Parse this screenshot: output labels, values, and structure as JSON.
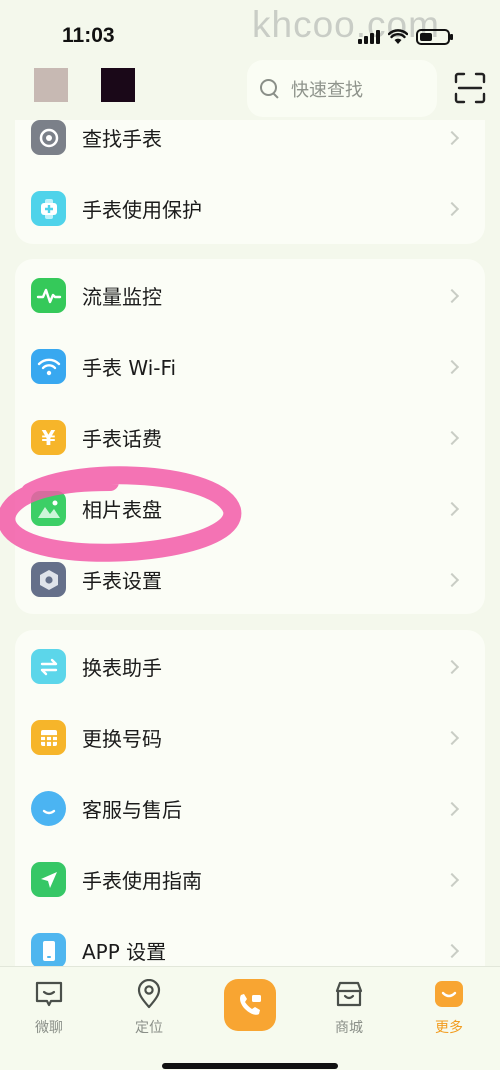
{
  "status_bar": {
    "time": "11:03",
    "watermark": "khcoo.com"
  },
  "search": {
    "placeholder": "快速查找"
  },
  "card1": {
    "items": [
      {
        "label": "查找手表",
        "icon": "target-icon",
        "color": "#7b8089"
      },
      {
        "label": "手表使用保护",
        "icon": "watch-plus-icon",
        "color": "#4fd3ea"
      }
    ]
  },
  "card2": {
    "items": [
      {
        "label": "流量监控",
        "icon": "pulse-icon",
        "color": "#35c95a"
      },
      {
        "label": "手表 Wi-Fi",
        "icon": "wifi-icon",
        "color": "#38a8f0"
      },
      {
        "label": "手表话费",
        "icon": "yen-icon",
        "color": "#f6b52a"
      },
      {
        "label": "相片表盘",
        "icon": "photo-icon",
        "color": "#3ccf66"
      },
      {
        "label": "手表设置",
        "icon": "hexagon-gear-icon",
        "color": "#65708a"
      }
    ]
  },
  "card3": {
    "items": [
      {
        "label": "换表助手",
        "icon": "swap-icon",
        "color": "#5cd6ea"
      },
      {
        "label": "更换号码",
        "icon": "sim-card-icon",
        "color": "#f6b52a"
      },
      {
        "label": "客服与售后",
        "icon": "chat-smile-icon",
        "color": "#4bb4f2"
      },
      {
        "label": "手表使用指南",
        "icon": "navigation-arrow-icon",
        "color": "#36c766"
      },
      {
        "label": "APP 设置",
        "icon": "phone-icon",
        "color": "#4fb6ef"
      }
    ]
  },
  "tabs": [
    {
      "label": "微聊",
      "icon": "chat-icon",
      "active": false
    },
    {
      "label": "定位",
      "icon": "location-pin-icon",
      "active": false
    },
    {
      "label": "",
      "icon": "video-call-icon",
      "active": false
    },
    {
      "label": "商城",
      "icon": "store-icon",
      "active": false
    },
    {
      "label": "更多",
      "icon": "more-icon",
      "active": true
    }
  ],
  "colors": {
    "accent": "#f29c1f",
    "background": "#f4f8ec",
    "card": "#fbfdf6"
  }
}
